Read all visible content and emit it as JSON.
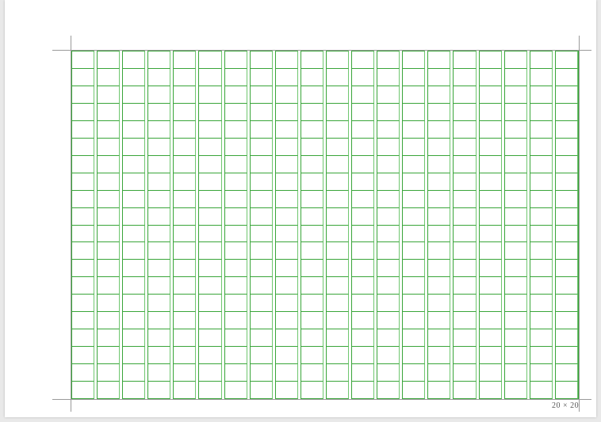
{
  "grid": {
    "columns": 20,
    "rows": 20,
    "line_color": "#39a539"
  },
  "footer": {
    "dimensions_label": "20 × 20"
  }
}
